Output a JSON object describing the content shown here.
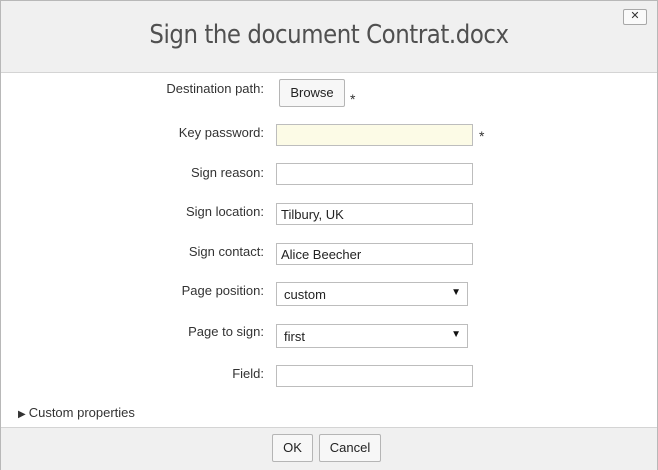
{
  "dialog": {
    "title": "Sign the document Contrat.docx",
    "close_label": "✕"
  },
  "form": {
    "destination_path": {
      "label": "Destination path:",
      "button_label": "Browse",
      "required_mark": "*"
    },
    "key_password": {
      "label": "Key password:",
      "value": "",
      "required_mark": "*"
    },
    "sign_reason": {
      "label": "Sign reason:",
      "value": ""
    },
    "sign_location": {
      "label": "Sign location:",
      "value": "Tilbury, UK"
    },
    "sign_contact": {
      "label": "Sign contact:",
      "value": "Alice Beecher"
    },
    "page_position": {
      "label": "Page position:",
      "selected": "custom"
    },
    "page_to_sign": {
      "label": "Page to sign:",
      "selected": "first"
    },
    "field": {
      "label": "Field:",
      "value": ""
    }
  },
  "custom_properties": {
    "label": "Custom properties",
    "arrow": "▶"
  },
  "footer": {
    "ok_label": "OK",
    "cancel_label": "Cancel"
  },
  "colors": {
    "required_field_bg": "#fcfbe6",
    "header_bg": "#f0f0f0"
  }
}
